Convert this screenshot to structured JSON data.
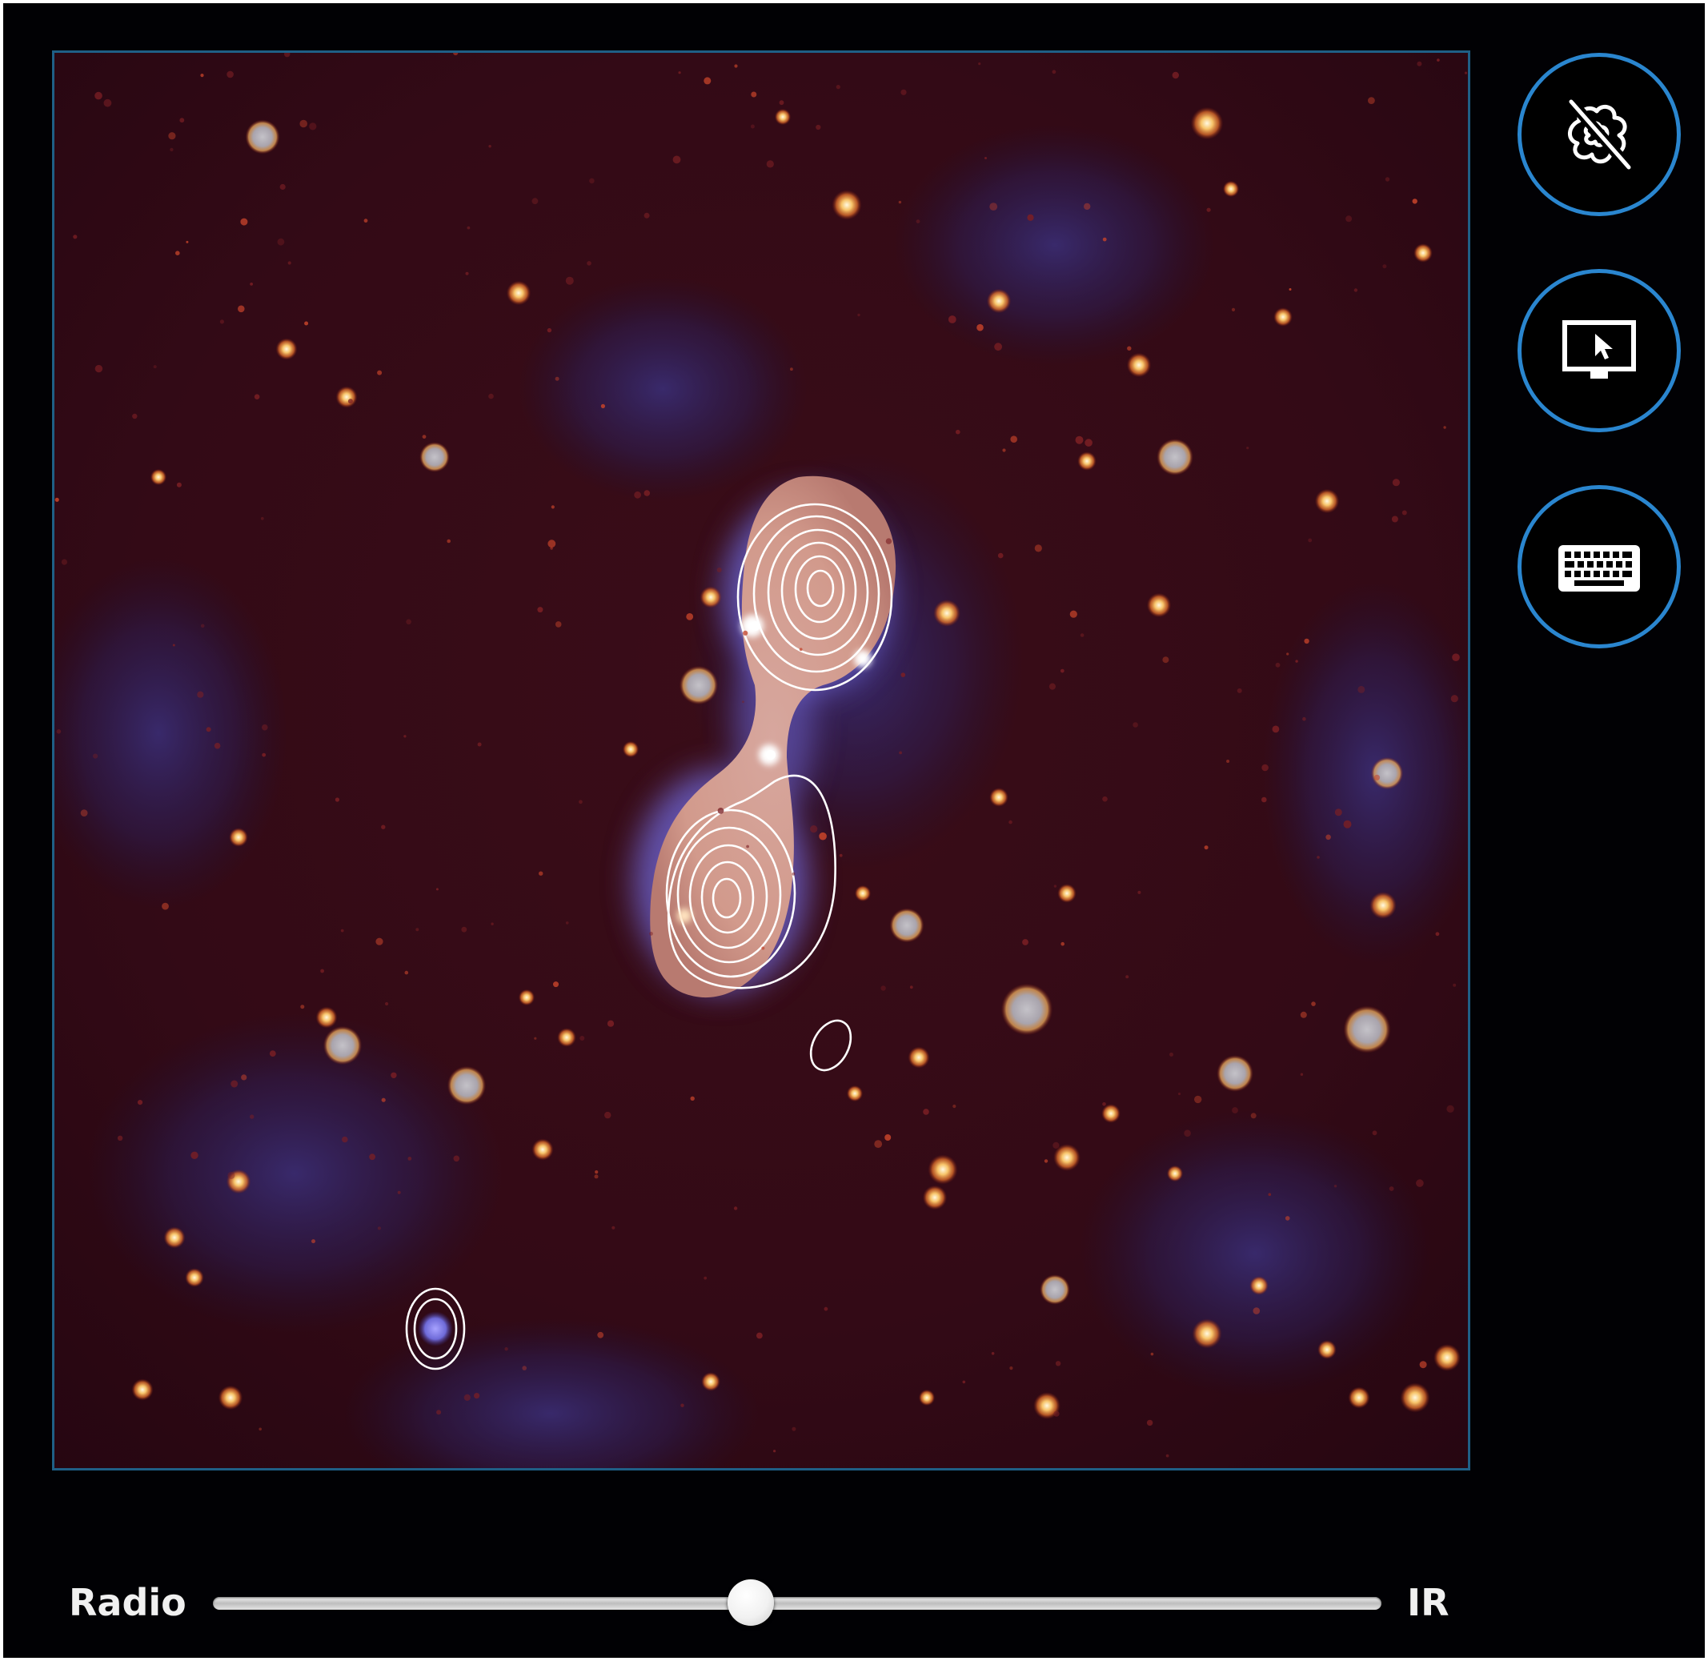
{
  "viewer": {
    "image_name": "radio-ir-sky-image",
    "colors": {
      "frame_border": "#1f5f86",
      "button_ring": "#2a86cf",
      "background": "#010104",
      "contour_line": "#ffffff"
    }
  },
  "toolbar": {
    "buttons": [
      {
        "name": "hide-contours-button",
        "icon": "contours-hidden-icon"
      },
      {
        "name": "select-source-button",
        "icon": "monitor-cursor-icon"
      },
      {
        "name": "keyboard-button",
        "icon": "keyboard-icon"
      }
    ]
  },
  "blend_slider": {
    "left_label": "Radio",
    "right_label": "IR",
    "value": 0.46
  }
}
